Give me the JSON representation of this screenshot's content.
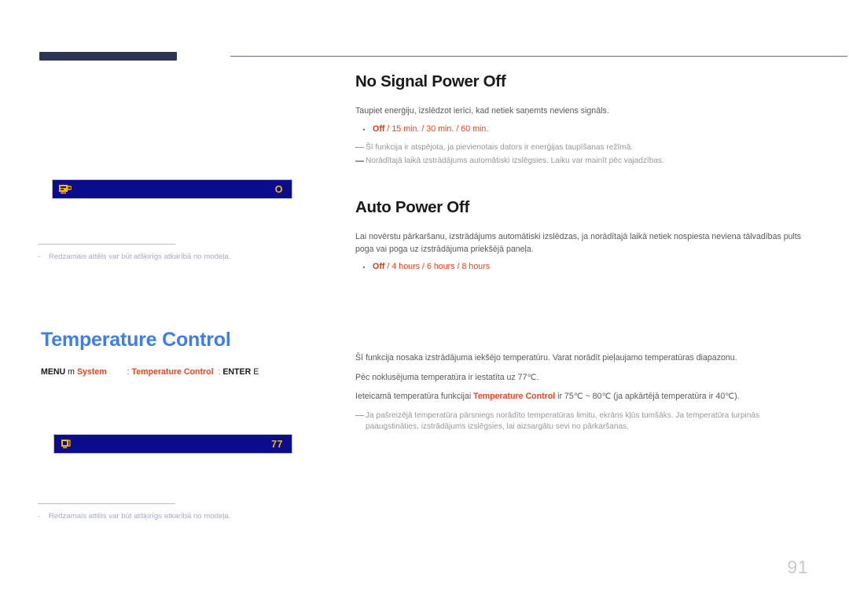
{
  "page": {
    "number": "91"
  },
  "left": {
    "figure1": {
      "osd": {
        "icon_name": "monitor-power-icon",
        "value": "O"
      },
      "caption_dash": "-",
      "caption": "Redzamais attēls var būt atšķirīgs atkarībā no modeļa."
    },
    "heading": "Temperature Control",
    "menu_path": {
      "menu_label": "MENU",
      "menu_icon": "m",
      "first": "System",
      "sep1": ":",
      "second": "Temperature Control",
      "sep2": ":",
      "enter_label": "ENTER",
      "enter_icon": "E"
    },
    "figure2": {
      "osd": {
        "icon_name": "thermometer-icon",
        "value": "77"
      },
      "caption_dash": "-",
      "caption": "Redzamais attēls var būt atšķirīgs atkarībā no modeļa."
    }
  },
  "right": {
    "no_signal": {
      "title": "No Signal Power Off",
      "intro": "Taupiet enerģiju, izslēdzot ierīci, kad netiek saņemts neviens signāls.",
      "bullet": {
        "first": "Off",
        "rest": " / 15 min. / 30 min. / 60 min."
      },
      "notes": [
        "Šī funkcija ir atspējota, ja pievienotais dators ir enerģijas taupīšanas režīmā.",
        "Norādītajā laikā izstrādājums automātiski izslēgsies. Laiku var mainīt pēc vajadzības."
      ]
    },
    "auto_power_off": {
      "title": "Auto Power Off",
      "intro": "Lai novērstu pārkaršanu, izstrādājums automātiski izslēdzas, ja norādītajā laikā netiek nospiesta neviena tālvadības pults poga vai poga uz izstrādājuma priekšējā paneļa.",
      "bullet": {
        "first": "Off",
        "rest": " / 4 hours / 6 hours / 8 hours"
      }
    },
    "temperature_control": {
      "line1": "Šī funkcija nosaka izstrādājuma iekšējo temperatūru. Varat norādīt pieļaujamo temperatūras diapazonu.",
      "line2": "Pēc noklusējuma temperatūra ir iestatīta uz 77℃.",
      "line3_pre": "Ieteicamā temperatūra funkcijai ",
      "line3_hl": "Temperature Control",
      "line3_post": " ir 75℃ ~ 80℃ (ja apkārtējā temperatūra ir 40℃).",
      "note": "Ja pašreizējā temperatūra pārsniegs norādīto temperatūras limitu, ekrāns kļūs tumšāks. Ja temperatūra turpinās paaugstināties, izstrādājums izslēgsies, lai aizsargātu sevi no pārkaršanas."
    }
  },
  "colors": {
    "accent_blue": "#3d7fe8",
    "accent_red": "#e8441f",
    "header_bar": "#2c3553",
    "osd_background": "#0b0b8e",
    "osd_text": "#f5b800"
  }
}
